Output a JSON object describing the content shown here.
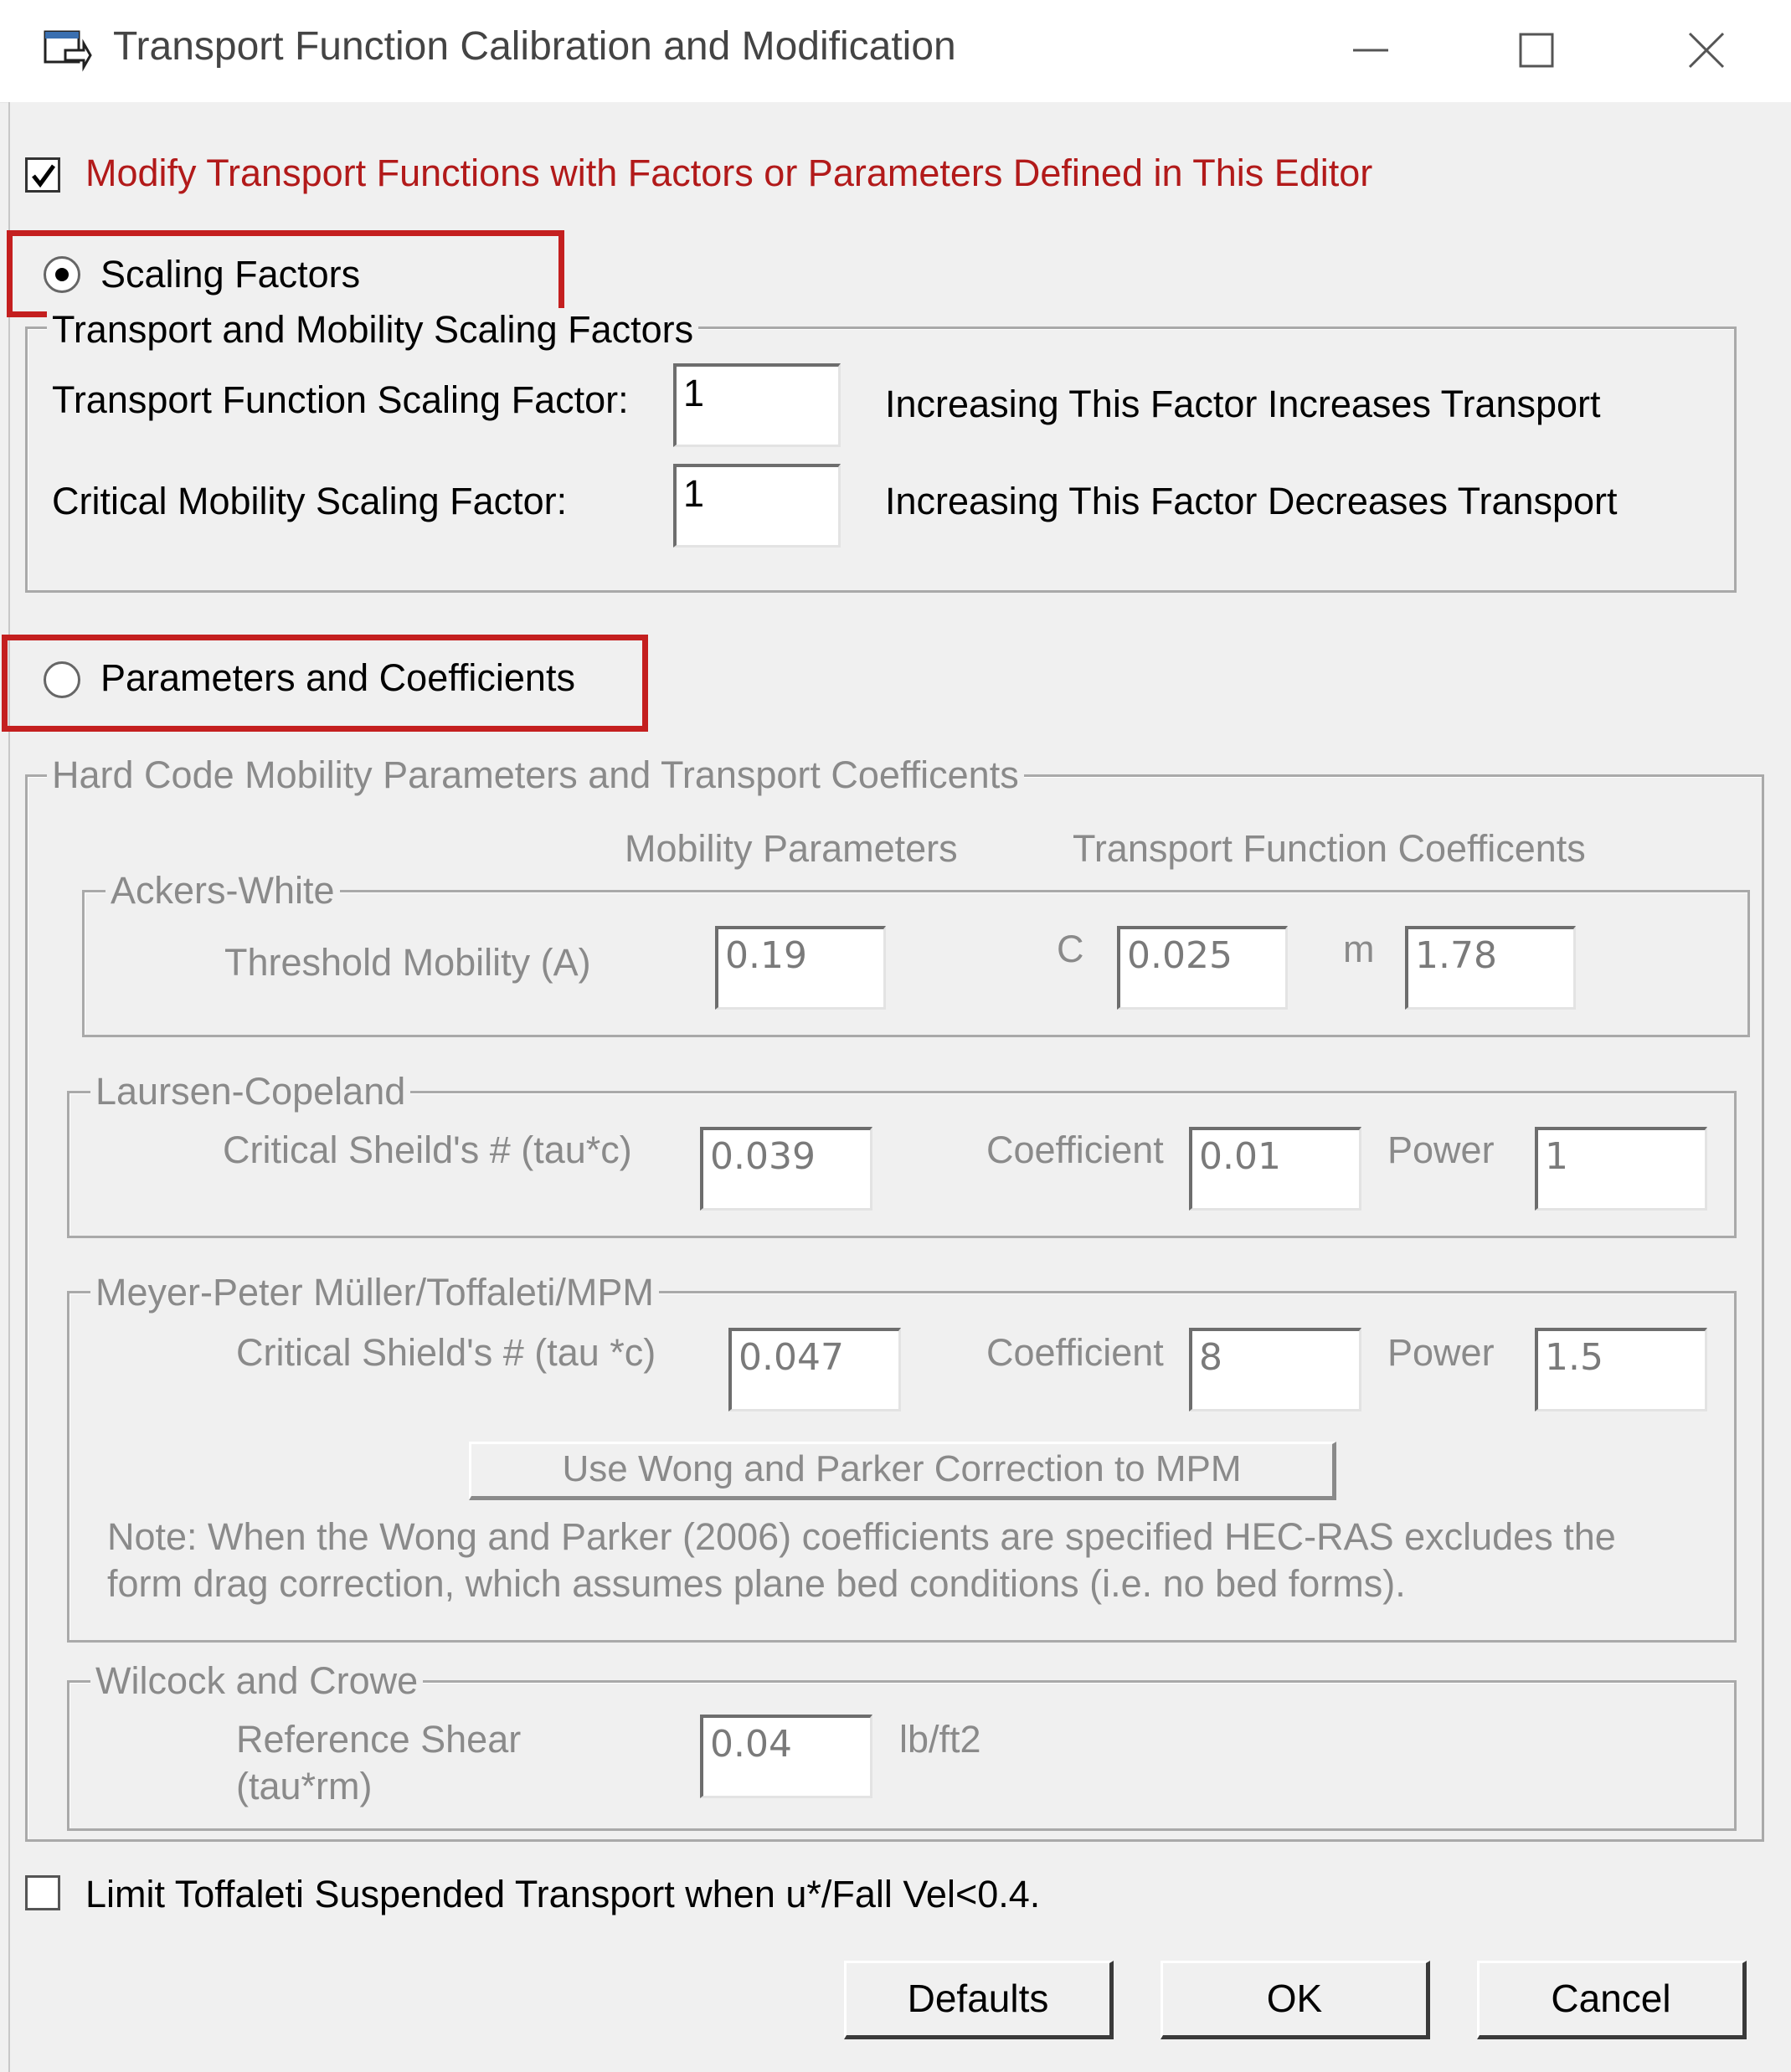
{
  "window": {
    "title": "Transport Function Calibration and Modification",
    "icon": "window-app-icon",
    "minimize_icon": "minimize-icon",
    "maximize_icon": "maximize-icon",
    "close_icon": "close-icon"
  },
  "modify_checkbox": {
    "checked": true,
    "label": "Modify Transport Functions with Factors or Parameters Defined in This Editor",
    "label_color": "#b21a1a"
  },
  "scaling_option": {
    "selected": true,
    "label": "Scaling Factors",
    "group_title": "Transport and Mobility Scaling Factors",
    "transport_label": "Transport Function Scaling Factor:",
    "transport_value": "1",
    "transport_hint": "Increasing This Factor Increases Transport",
    "mobility_label": "Critical Mobility Scaling Factor:",
    "mobility_value": "1",
    "mobility_hint": "Increasing This Factor Decreases Transport"
  },
  "parameters_option": {
    "selected": false,
    "label": "Parameters and Coefficients",
    "group_title": "Hard Code Mobility Parameters and Transport Coefficents",
    "col_mobility": "Mobility Parameters",
    "col_transport": "Transport Function Coefficents",
    "ackers_white": {
      "title": "Ackers-White",
      "threshold_label": "Threshold Mobility (A)",
      "threshold_value": "0.19",
      "c_label": "C",
      "c_value": "0.025",
      "m_label": "m",
      "m_value": "1.78"
    },
    "laursen": {
      "title": "Laursen-Copeland",
      "shields_label": "Critical Sheild's # (tau*c)",
      "shields_value": "0.039",
      "coef_label": "Coefficient",
      "coef_value": "0.01",
      "power_label": "Power",
      "power_value": "1"
    },
    "mpm": {
      "title": "Meyer-Peter Müller/Toffaleti/MPM",
      "shields_label": "Critical Shield's # (tau *c)",
      "shields_value": "0.047",
      "coef_label": "Coefficient",
      "coef_value": "8",
      "power_label": "Power",
      "power_value": "1.5",
      "wong_button": "Use Wong and Parker Correction to MPM",
      "note_line1": "Note: When the Wong and Parker (2006) coefficients are specified HEC-RAS excludes the",
      "note_line2": "form drag correction, which assumes plane bed conditions (i.e. no bed forms)."
    },
    "wilcock": {
      "title": "Wilcock and Crowe",
      "ref_label_line1": "Reference Shear",
      "ref_label_line2": "(tau*rm)",
      "ref_value": "0.04",
      "unit": "lb/ft2"
    }
  },
  "toffaleti_checkbox": {
    "checked": false,
    "label": "Limit Toffaleti Suspended Transport when u*/Fall Vel<0.4."
  },
  "buttons": {
    "defaults": "Defaults",
    "ok": "OK",
    "cancel": "Cancel"
  },
  "highlight_color": "#c41f1f"
}
